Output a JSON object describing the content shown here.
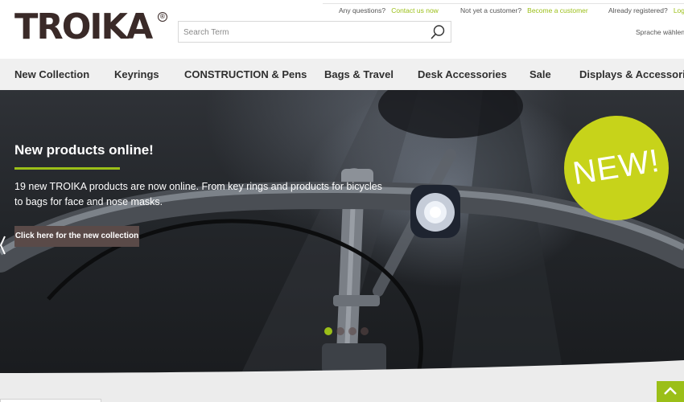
{
  "brand": {
    "logo_text": "TROIKA",
    "logo_mark": "®",
    "accent_color": "#9bbf18",
    "nav_bg": "#f0f0f0",
    "cta_bg": "#5a4a48"
  },
  "header": {
    "questions_label": "Any questions?",
    "contact_link": "Contact us now",
    "not_customer_label": "Not yet a customer?",
    "become_link": "Become a customer",
    "registered_label": "Already registered?",
    "login_link": "Log i",
    "search_placeholder": "Search Term",
    "search_icon": "search-icon",
    "language_label": "Sprache wählen"
  },
  "nav": {
    "items": [
      "New Collection",
      "Keyrings",
      "CONSTRUCTION & Pens",
      "Bags & Travel",
      "Desk Accessories",
      "Sale",
      "Displays & Accessories"
    ]
  },
  "hero": {
    "title": "New products online!",
    "text": "19 new TROIKA products are now online. From key rings and products for bicycles to bags for face and nose masks.",
    "cta_label": "Click here for the new collection",
    "badge_text": "NEW!",
    "slides_total": 4,
    "slide_active": 1
  }
}
